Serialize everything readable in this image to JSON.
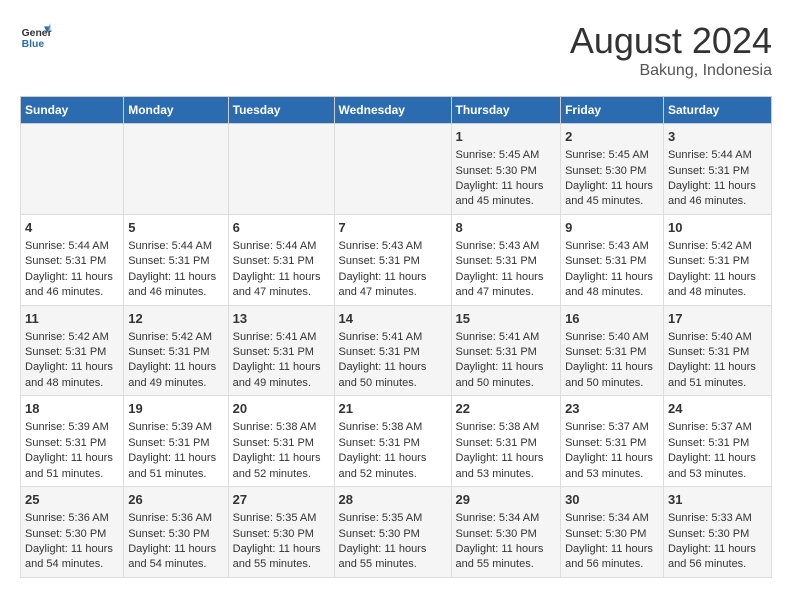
{
  "header": {
    "logo_line1": "General",
    "logo_line2": "Blue",
    "main_title": "August 2024",
    "subtitle": "Bakung, Indonesia"
  },
  "calendar": {
    "days_of_week": [
      "Sunday",
      "Monday",
      "Tuesday",
      "Wednesday",
      "Thursday",
      "Friday",
      "Saturday"
    ],
    "weeks": [
      [
        {
          "day": "",
          "content": ""
        },
        {
          "day": "",
          "content": ""
        },
        {
          "day": "",
          "content": ""
        },
        {
          "day": "",
          "content": ""
        },
        {
          "day": "1",
          "content": "Sunrise: 5:45 AM\nSunset: 5:30 PM\nDaylight: 11 hours and 45 minutes."
        },
        {
          "day": "2",
          "content": "Sunrise: 5:45 AM\nSunset: 5:30 PM\nDaylight: 11 hours and 45 minutes."
        },
        {
          "day": "3",
          "content": "Sunrise: 5:44 AM\nSunset: 5:31 PM\nDaylight: 11 hours and 46 minutes."
        }
      ],
      [
        {
          "day": "4",
          "content": "Sunrise: 5:44 AM\nSunset: 5:31 PM\nDaylight: 11 hours and 46 minutes."
        },
        {
          "day": "5",
          "content": "Sunrise: 5:44 AM\nSunset: 5:31 PM\nDaylight: 11 hours and 46 minutes."
        },
        {
          "day": "6",
          "content": "Sunrise: 5:44 AM\nSunset: 5:31 PM\nDaylight: 11 hours and 47 minutes."
        },
        {
          "day": "7",
          "content": "Sunrise: 5:43 AM\nSunset: 5:31 PM\nDaylight: 11 hours and 47 minutes."
        },
        {
          "day": "8",
          "content": "Sunrise: 5:43 AM\nSunset: 5:31 PM\nDaylight: 11 hours and 47 minutes."
        },
        {
          "day": "9",
          "content": "Sunrise: 5:43 AM\nSunset: 5:31 PM\nDaylight: 11 hours and 48 minutes."
        },
        {
          "day": "10",
          "content": "Sunrise: 5:42 AM\nSunset: 5:31 PM\nDaylight: 11 hours and 48 minutes."
        }
      ],
      [
        {
          "day": "11",
          "content": "Sunrise: 5:42 AM\nSunset: 5:31 PM\nDaylight: 11 hours and 48 minutes."
        },
        {
          "day": "12",
          "content": "Sunrise: 5:42 AM\nSunset: 5:31 PM\nDaylight: 11 hours and 49 minutes."
        },
        {
          "day": "13",
          "content": "Sunrise: 5:41 AM\nSunset: 5:31 PM\nDaylight: 11 hours and 49 minutes."
        },
        {
          "day": "14",
          "content": "Sunrise: 5:41 AM\nSunset: 5:31 PM\nDaylight: 11 hours and 50 minutes."
        },
        {
          "day": "15",
          "content": "Sunrise: 5:41 AM\nSunset: 5:31 PM\nDaylight: 11 hours and 50 minutes."
        },
        {
          "day": "16",
          "content": "Sunrise: 5:40 AM\nSunset: 5:31 PM\nDaylight: 11 hours and 50 minutes."
        },
        {
          "day": "17",
          "content": "Sunrise: 5:40 AM\nSunset: 5:31 PM\nDaylight: 11 hours and 51 minutes."
        }
      ],
      [
        {
          "day": "18",
          "content": "Sunrise: 5:39 AM\nSunset: 5:31 PM\nDaylight: 11 hours and 51 minutes."
        },
        {
          "day": "19",
          "content": "Sunrise: 5:39 AM\nSunset: 5:31 PM\nDaylight: 11 hours and 51 minutes."
        },
        {
          "day": "20",
          "content": "Sunrise: 5:38 AM\nSunset: 5:31 PM\nDaylight: 11 hours and 52 minutes."
        },
        {
          "day": "21",
          "content": "Sunrise: 5:38 AM\nSunset: 5:31 PM\nDaylight: 11 hours and 52 minutes."
        },
        {
          "day": "22",
          "content": "Sunrise: 5:38 AM\nSunset: 5:31 PM\nDaylight: 11 hours and 53 minutes."
        },
        {
          "day": "23",
          "content": "Sunrise: 5:37 AM\nSunset: 5:31 PM\nDaylight: 11 hours and 53 minutes."
        },
        {
          "day": "24",
          "content": "Sunrise: 5:37 AM\nSunset: 5:31 PM\nDaylight: 11 hours and 53 minutes."
        }
      ],
      [
        {
          "day": "25",
          "content": "Sunrise: 5:36 AM\nSunset: 5:30 PM\nDaylight: 11 hours and 54 minutes."
        },
        {
          "day": "26",
          "content": "Sunrise: 5:36 AM\nSunset: 5:30 PM\nDaylight: 11 hours and 54 minutes."
        },
        {
          "day": "27",
          "content": "Sunrise: 5:35 AM\nSunset: 5:30 PM\nDaylight: 11 hours and 55 minutes."
        },
        {
          "day": "28",
          "content": "Sunrise: 5:35 AM\nSunset: 5:30 PM\nDaylight: 11 hours and 55 minutes."
        },
        {
          "day": "29",
          "content": "Sunrise: 5:34 AM\nSunset: 5:30 PM\nDaylight: 11 hours and 55 minutes."
        },
        {
          "day": "30",
          "content": "Sunrise: 5:34 AM\nSunset: 5:30 PM\nDaylight: 11 hours and 56 minutes."
        },
        {
          "day": "31",
          "content": "Sunrise: 5:33 AM\nSunset: 5:30 PM\nDaylight: 11 hours and 56 minutes."
        }
      ]
    ]
  }
}
